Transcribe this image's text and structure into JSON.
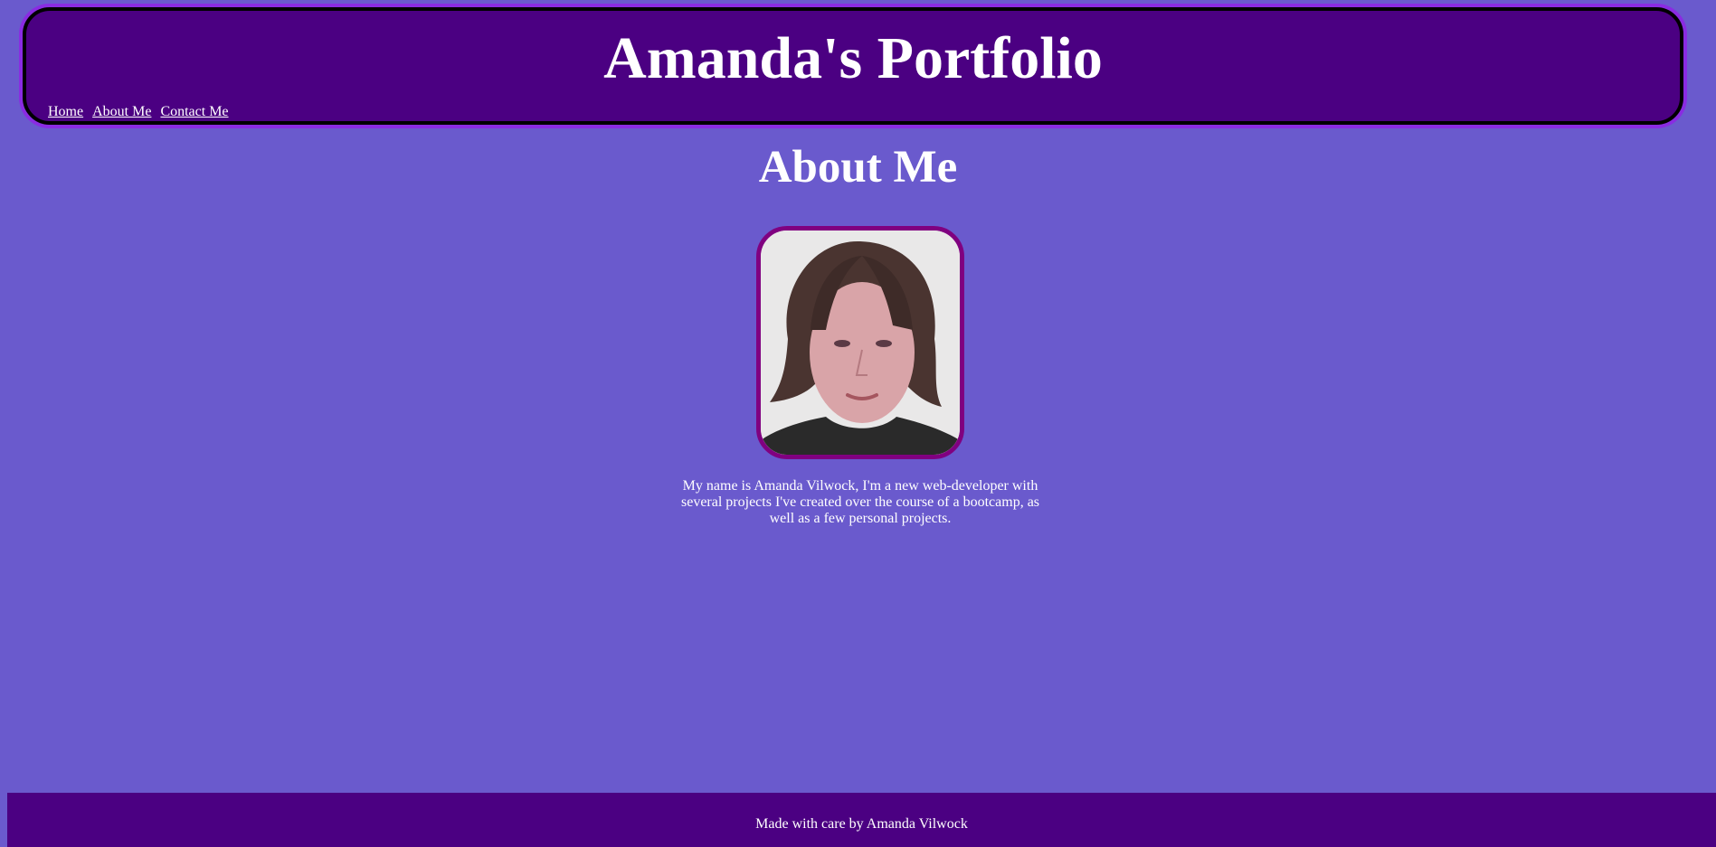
{
  "header": {
    "title": "Amanda's Portfolio",
    "nav": [
      {
        "label": "Home"
      },
      {
        "label": "About Me"
      },
      {
        "label": "Contact Me"
      }
    ]
  },
  "main": {
    "heading": "About Me",
    "bio": "My name is Amanda Vilwock, I'm a new web-developer with several projects I've created over the course of a bootcamp, as well as a few personal projects."
  },
  "footer": {
    "text": "Made with care by Amanda Vilwock"
  },
  "colors": {
    "background": "#6a5acd",
    "header_bg": "#4b0082",
    "header_outline": "#8a2be2",
    "photo_border": "#800080",
    "text": "#ffffff"
  }
}
